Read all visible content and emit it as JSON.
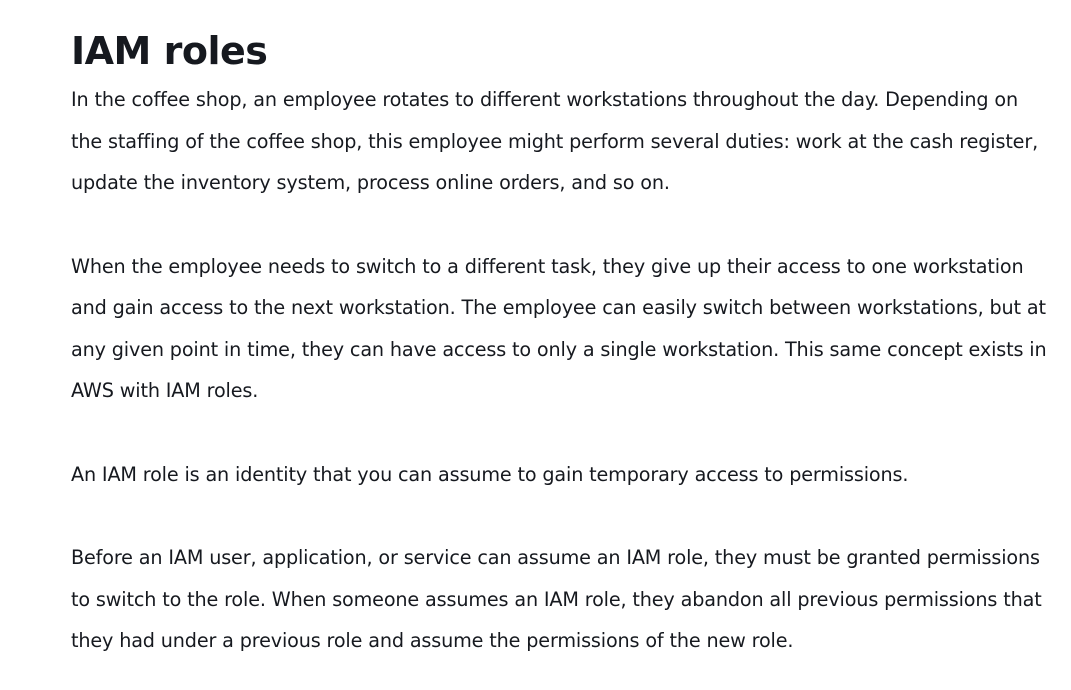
{
  "page": {
    "title": "IAM roles",
    "paragraphs": [
      "In the coffee shop, an employee rotates to different workstations throughout the day. Depending on the staffing of the coffee shop, this employee might perform several duties: work at the cash register, update the inventory system, process online orders, and so on.",
      "When the employee needs to switch to a different task, they give up their access to one workstation and gain access to the next workstation. The employee can easily switch between workstations, but at any given point in time, they can have access to only a single workstation. This same concept exists in AWS with IAM roles.",
      "An IAM role is an identity that you can assume to gain temporary access to permissions.",
      "Before an IAM user, application, or service can assume an IAM role, they must be granted permissions to switch to the role. When someone assumes an IAM role, they abandon all previous permissions that they had under a previous role and assume the permissions of the new role."
    ]
  }
}
